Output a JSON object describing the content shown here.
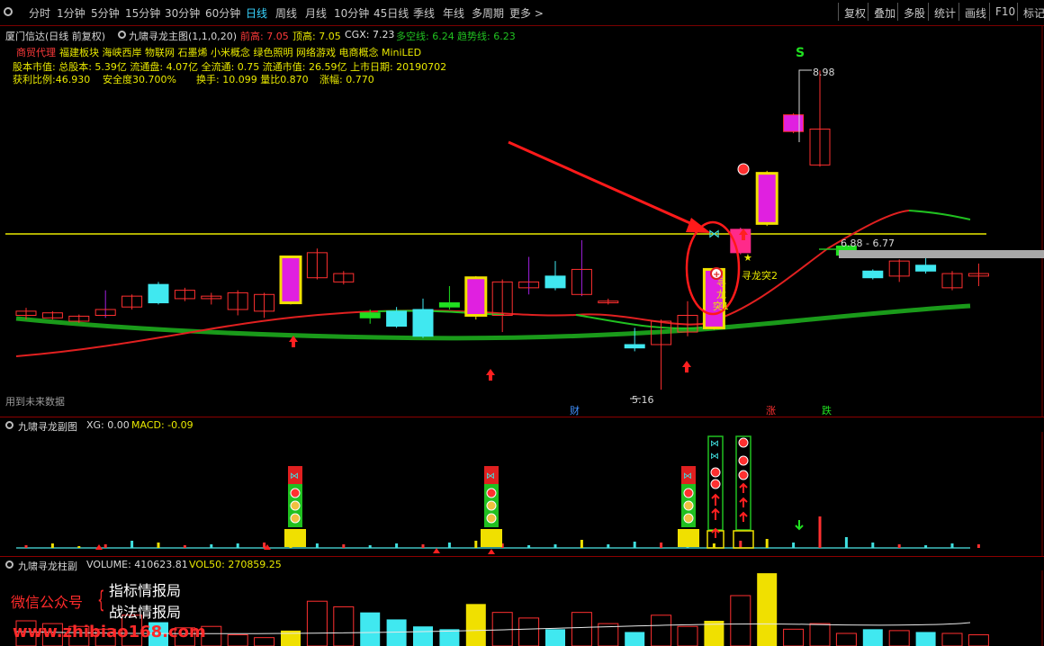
{
  "toolbar": {
    "periods": [
      "分时",
      "1分钟",
      "5分钟",
      "15分钟",
      "30分钟",
      "60分钟",
      "日线",
      "周线",
      "月线",
      "10分钟",
      "45日线",
      "季线",
      "年线",
      "多周期",
      "更多 >"
    ],
    "active_index": 6,
    "right_buttons": [
      "复权",
      "叠加",
      "多股",
      "统计",
      "画线",
      "F10",
      "标记"
    ]
  },
  "main_header": {
    "stock": "厦门信达(日线 前复权)",
    "indicator": "九啸寻龙主图(1,1,0,20)",
    "qiangao": "前高: 7.05",
    "dinggao": "顶高: 7.05",
    "cgx": "CGX: 7.23",
    "duokong": "多空线: 6.24",
    "qushi": "趋势线: 6.23",
    "line1_red": "商贸代理",
    "line1_yellow": "福建板块   海峡西岸 物联网 石墨烯 小米概念 绿色照明 网络游戏 电商概念 MiniLED",
    "line2": "股本市值: 总股本: 5.39亿 流通盘: 4.07亿 全流通: 0.75 流通市值: 26.59亿 上市日期: 20190702",
    "line3_a": "获利比例:46.930",
    "line3_b": "安全度30.700%",
    "line3_c": "换手: 10.099 量比0.870",
    "line3_d": "涨幅: 0.770",
    "future_note": "用到未来数据"
  },
  "chart_annotations": {
    "signal_s": "S",
    "high_label": "8.98",
    "low_label": "5.16",
    "range_label": "6.88 - 6.77",
    "xunlong1": "寻\n龙\n突1",
    "xunlong2": "寻龙突2",
    "cai": "财",
    "zhang": "涨",
    "die": "跌"
  },
  "sub1_header": {
    "title": "九啸寻龙副图",
    "xg": "XG: 0.00",
    "macd": "MACD: -0.09"
  },
  "sub2_header": {
    "title": "九啸寻龙柱副",
    "volume": "VOLUME: 410623.81",
    "vol50": "VOL50: 270859.25"
  },
  "watermark": {
    "left": "微信公众号",
    "top": "指标情报局",
    "bottom": "战法情报局",
    "url": "www.zhibiao168.com"
  },
  "chart_data": {
    "type": "candlestick",
    "ylim": [
      5.0,
      9.2
    ],
    "candles": [
      {
        "o": 6.05,
        "c": 6.1,
        "h": 6.14,
        "l": 6.0
      },
      {
        "o": 6.02,
        "c": 6.08,
        "h": 6.1,
        "l": 6.0
      },
      {
        "o": 5.98,
        "c": 6.04,
        "h": 6.06,
        "l": 5.96
      },
      {
        "o": 6.05,
        "c": 6.12,
        "h": 6.35,
        "l": 6.02
      },
      {
        "o": 6.15,
        "c": 6.28,
        "h": 6.3,
        "l": 6.12
      },
      {
        "o": 6.42,
        "c": 6.2,
        "h": 6.45,
        "l": 6.18
      },
      {
        "o": 6.25,
        "c": 6.35,
        "h": 6.38,
        "l": 6.22
      },
      {
        "o": 6.25,
        "c": 6.28,
        "h": 6.32,
        "l": 6.18
      },
      {
        "o": 6.12,
        "c": 6.32,
        "h": 6.35,
        "l": 6.05
      },
      {
        "o": 6.1,
        "c": 6.3,
        "h": 6.32,
        "l": 6.02
      },
      {
        "o": 6.2,
        "c": 6.75,
        "h": 6.76,
        "l": 6.18
      },
      {
        "o": 6.5,
        "c": 6.8,
        "h": 6.85,
        "l": 6.48
      },
      {
        "o": 6.45,
        "c": 6.55,
        "h": 6.58,
        "l": 6.42
      },
      {
        "o": 6.08,
        "c": 6.02,
        "h": 6.12,
        "l": 5.95
      },
      {
        "o": 6.1,
        "c": 5.92,
        "h": 6.15,
        "l": 5.9
      },
      {
        "o": 6.12,
        "c": 5.8,
        "h": 6.25,
        "l": 5.78
      },
      {
        "o": 6.2,
        "c": 6.15,
        "h": 6.4,
        "l": 6.12
      },
      {
        "o": 6.5,
        "c": 6.05,
        "h": 6.52,
        "l": 6.0
      },
      {
        "o": 6.05,
        "c": 6.45,
        "h": 6.48,
        "l": 5.85
      },
      {
        "o": 6.38,
        "c": 6.45,
        "h": 6.75,
        "l": 6.3
      },
      {
        "o": 6.52,
        "c": 6.38,
        "h": 6.7,
        "l": 6.35
      },
      {
        "o": 6.3,
        "c": 6.6,
        "h": 6.95,
        "l": 6.28
      },
      {
        "o": 6.2,
        "c": 6.22,
        "h": 6.25,
        "l": 6.18
      },
      {
        "o": 5.7,
        "c": 5.66,
        "h": 5.9,
        "l": 5.62
      },
      {
        "o": 5.7,
        "c": 5.98,
        "h": 6.0,
        "l": 5.16
      },
      {
        "o": 5.85,
        "c": 6.05,
        "h": 6.22,
        "l": 5.8
      },
      {
        "o": 5.9,
        "c": 6.6,
        "h": 6.62,
        "l": 5.88
      },
      {
        "o": 6.8,
        "c": 7.08,
        "h": 7.1,
        "l": 6.78
      },
      {
        "o": 7.15,
        "c": 7.75,
        "h": 7.78,
        "l": 7.12
      },
      {
        "o": 8.25,
        "c": 8.45,
        "h": 8.47,
        "l": 8.23
      },
      {
        "o": 7.85,
        "c": 8.28,
        "h": 8.98,
        "l": 7.83
      },
      {
        "o": 6.77,
        "c": 6.88,
        "h": 6.9,
        "l": 6.75
      },
      {
        "o": 6.58,
        "c": 6.5,
        "h": 6.6,
        "l": 6.48
      },
      {
        "o": 6.52,
        "c": 6.7,
        "h": 6.72,
        "l": 6.45
      },
      {
        "o": 6.65,
        "c": 6.58,
        "h": 6.79,
        "l": 6.55
      },
      {
        "o": 6.38,
        "c": 6.55,
        "h": 6.58,
        "l": 6.35
      },
      {
        "o": 6.52,
        "c": 6.55,
        "h": 6.67,
        "l": 6.4
      }
    ],
    "volume": [
      90,
      80,
      70,
      60,
      110,
      85,
      65,
      70,
      40,
      30,
      55,
      160,
      140,
      120,
      95,
      70,
      60,
      150,
      120,
      100,
      60,
      120,
      80,
      50,
      110,
      70,
      90,
      180,
      260,
      60,
      80,
      45,
      60,
      55,
      50,
      45,
      40
    ]
  }
}
